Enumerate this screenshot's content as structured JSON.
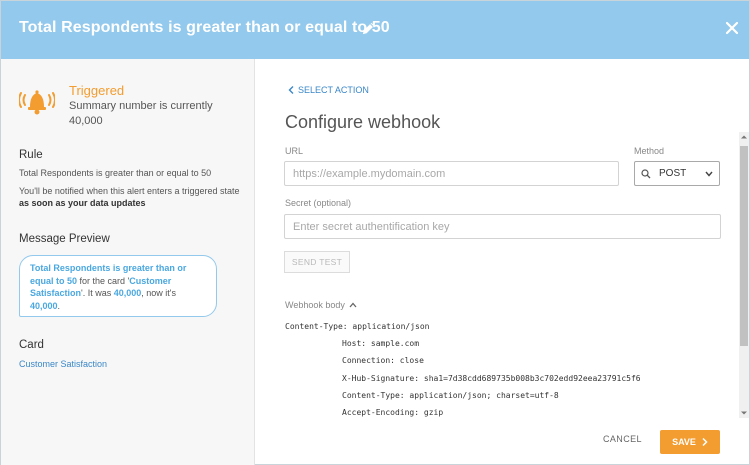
{
  "header": {
    "title": "Total Respondents is greater than or equal to 50",
    "color": "#93c9ec"
  },
  "status": {
    "title": "Triggered",
    "text": "Summary number is currently 40,000",
    "color": "#f39c2f"
  },
  "rule": {
    "heading": "Rule",
    "condition": "Total Respondents is greater than or equal to 50",
    "notice_prefix": "You'll be notified when this alert enters a triggered state",
    "notice_bold": "as soon as your data updates"
  },
  "message_preview": {
    "heading": "Message Preview",
    "metric": "Total Respondents is greater than or equal to 50",
    "part1": "for the card '",
    "card": "Customer Satisfaction",
    "part2": "'. It was",
    "was_value": "40,000",
    "part3": ", now it's",
    "now_value": "40,000",
    "end": "."
  },
  "card": {
    "heading": "Card",
    "link": "Customer Satisfaction"
  },
  "nav": {
    "back_label": "SELECT ACTION"
  },
  "form": {
    "title": "Configure webhook",
    "url_label": "URL",
    "url_placeholder": "https://example.mydomain.com",
    "url_value": "",
    "method_label": "Method",
    "method_value": "POST",
    "secret_label": "Secret (optional)",
    "secret_placeholder": "Enter secret authentification key",
    "secret_value": "",
    "send_test_label": "SEND TEST"
  },
  "webhook_body": {
    "label": "Webhook body",
    "lines": [
      "Content-Type: application/json",
      "Host: sample.com",
      "Connection: close",
      "X-Hub-Signature: sha1=7d38cdd689735b008b3c702edd92eea23791c5f6",
      "Content-Type: application/json; charset=utf-8",
      "Accept-Encoding: gzip"
    ]
  },
  "footer": {
    "cancel_label": "CANCEL",
    "save_label": "SAVE",
    "save_color": "#f39c2f"
  }
}
